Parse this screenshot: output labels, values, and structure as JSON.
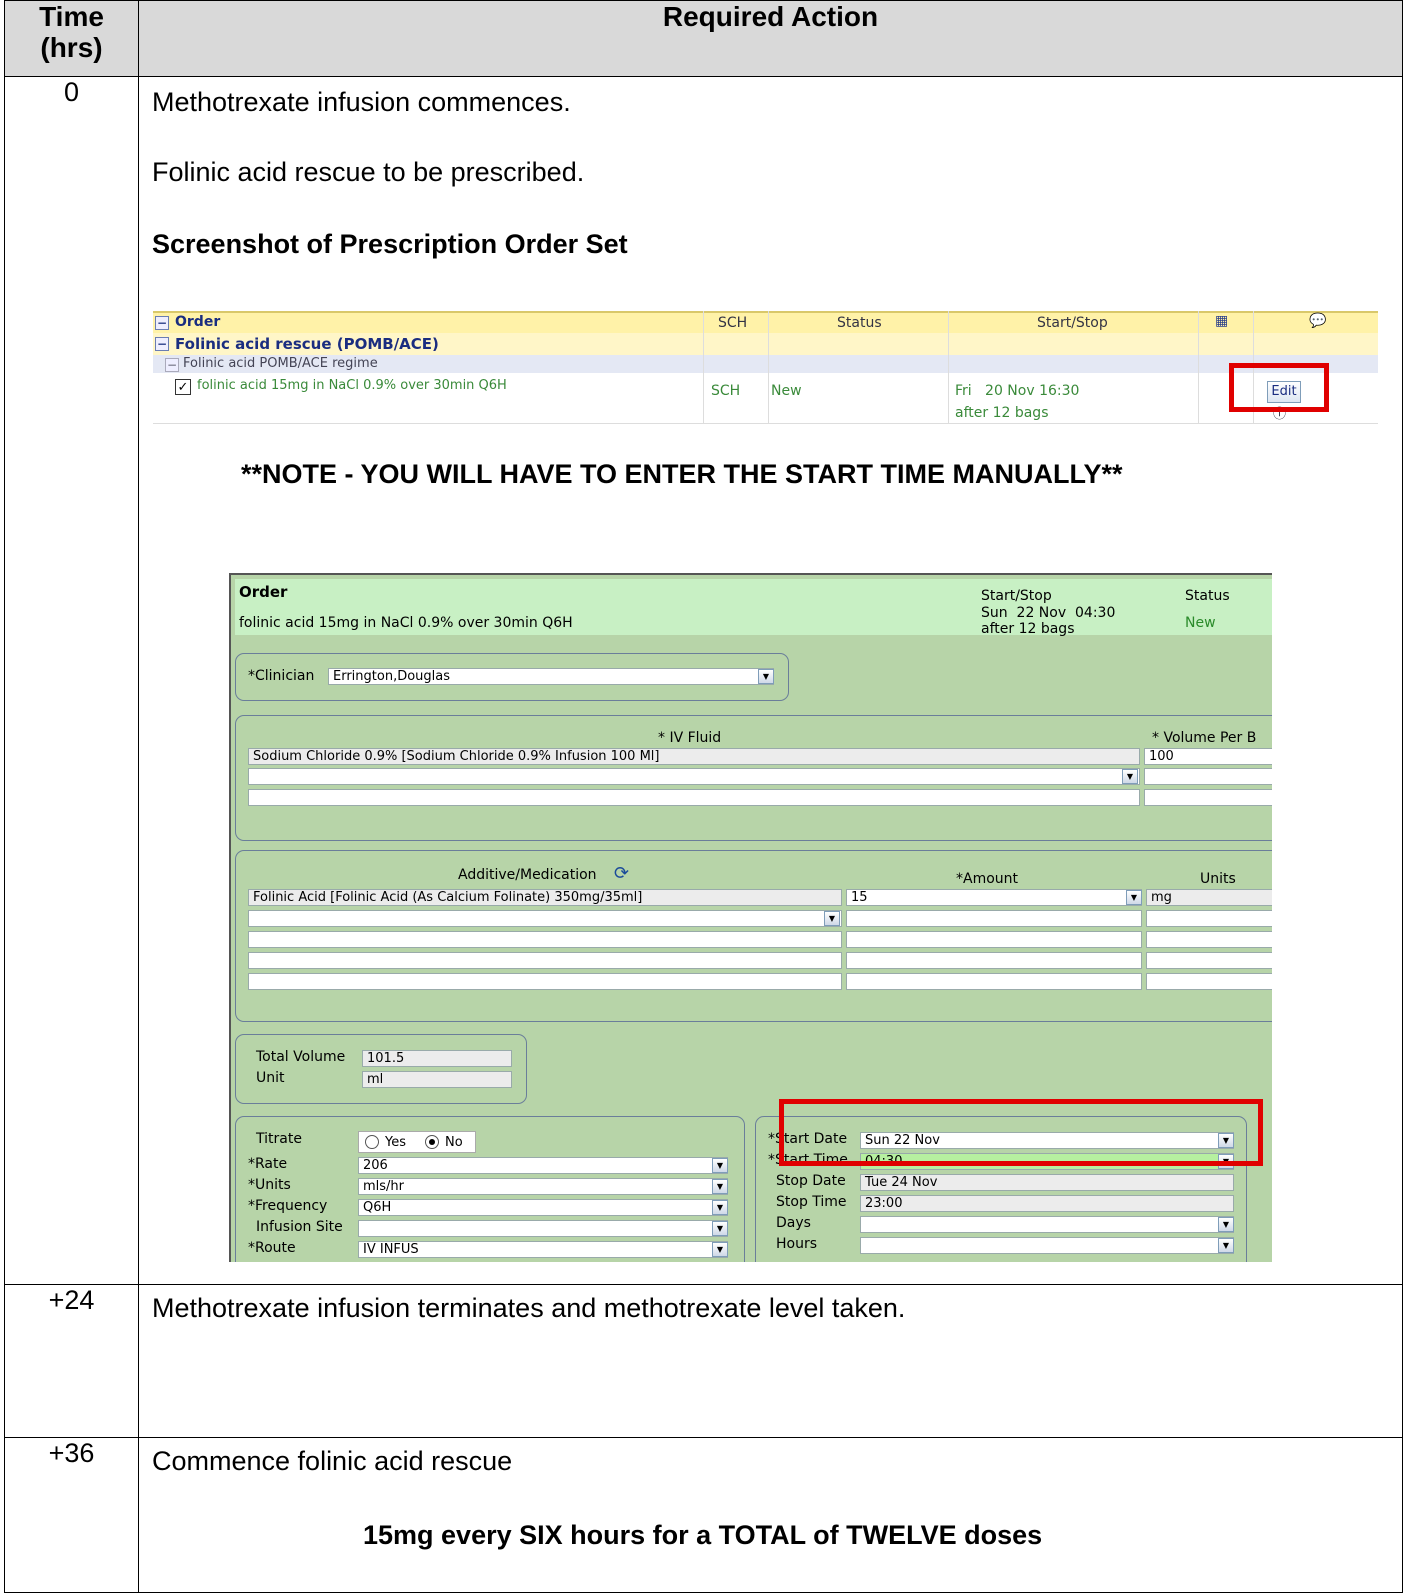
{
  "table": {
    "header_time": "Time (hrs)",
    "header_action": "Required Action",
    "rows": [
      {
        "time": "0",
        "lines": [
          "Methotrexate infusion commences.",
          "Folinic acid rescue to be prescribed.",
          "Screenshot of Prescription Order Set",
          "**NOTE - YOU WILL HAVE TO ENTER THE START TIME MANUALLY**"
        ]
      },
      {
        "time": "+24",
        "lines": [
          "Methotrexate infusion terminates and methotrexate level taken."
        ]
      },
      {
        "time": "+36",
        "lines": [
          "Commence folinic acid rescue",
          "15mg every SIX hours for a TOTAL of TWELVE doses"
        ]
      }
    ]
  },
  "order_set": {
    "col_order": "Order",
    "col_sch": "SCH",
    "col_status": "Status",
    "col_startstop": "Start/Stop",
    "group": "Folinic acid rescue (POMB/ACE)",
    "subgroup": "Folinic acid POMB/ACE regime",
    "item": "folinic acid 15mg in NaCl 0.9% over 30min Q6H",
    "item_sch": "SCH",
    "item_status": "New",
    "item_start": "Fri   20 Nov 16:30",
    "item_stop": "after 12 bags",
    "edit": "Edit"
  },
  "order_form": {
    "hdr_order": "Order",
    "hdr_startstop": "Start/Stop",
    "hdr_status": "Status",
    "order_text": "folinic acid 15mg in NaCl 0.9% over 30min Q6H",
    "order_start": "Sun  22 Nov  04:30",
    "order_stop": "after 12 bags",
    "order_status": "New",
    "clinician_label": "*Clinician",
    "clinician_value": "Errington,Douglas",
    "ivfluid_label": "* IV Fluid",
    "volume_label": "* Volume Per B",
    "ivfluid_value": "Sodium Chloride 0.9% [Sodium Chloride 0.9% Infusion 100 Ml]",
    "volume_value": "100",
    "additive_label": "Additive/Medication",
    "amount_label": "*Amount",
    "units_label": "Units",
    "additive_value": "Folinic Acid [Folinic Acid (As Calcium Folinate) 350mg/35ml]",
    "amount_value": "15",
    "units_value": "mg",
    "total_volume_label": "Total Volume",
    "total_volume_value": "101.5",
    "unit_label": "Unit",
    "unit_value": "ml",
    "titrate_label": "Titrate",
    "yes_label": "Yes",
    "no_label": "No",
    "rate_label": "*Rate",
    "rate_value": "206",
    "units2_label": "*Units",
    "units2_value": "mls/hr",
    "frequency_label": "*Frequency",
    "frequency_value": "Q6H",
    "infusion_site_label": "Infusion Site",
    "route_label": "*Route",
    "route_value": "IV INFUS",
    "start_date_label": "*Start Date",
    "start_date_value": "Sun 22 Nov",
    "start_time_label": "*Start Time",
    "start_time_value": "04:30",
    "stop_date_label": "Stop Date",
    "stop_date_value": "Tue 24 Nov",
    "stop_time_label": "Stop Time",
    "stop_time_value": "23:00",
    "days_label": "Days",
    "hours_label": "Hours"
  }
}
